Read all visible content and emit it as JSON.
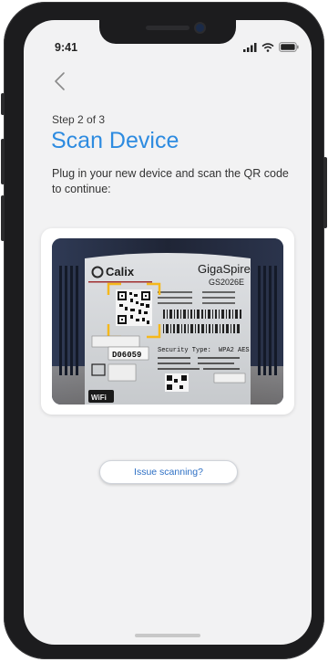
{
  "status": {
    "time": "9:41"
  },
  "header": {
    "step": "Step 2 of 3",
    "title": "Scan Device"
  },
  "instructions": "Plug in your new device and scan the QR code to continue:",
  "device": {
    "brand": "Calix",
    "model_name": "GigaSpire",
    "model_number": "GS2026E",
    "label_code": "D06059",
    "security_type_label": "Security Type:",
    "security_type_value": "WPA2 AES",
    "wifi_label": "WiFi"
  },
  "actions": {
    "issue_label": "Issue scanning?"
  },
  "colors": {
    "accent": "#2d8be0",
    "scan_frame": "#f5b81c",
    "device_body": "#1f2536"
  },
  "icons": {
    "back": "chevron-left-icon",
    "signal": "signal-icon",
    "wifi": "wifi-icon",
    "battery": "battery-icon"
  }
}
